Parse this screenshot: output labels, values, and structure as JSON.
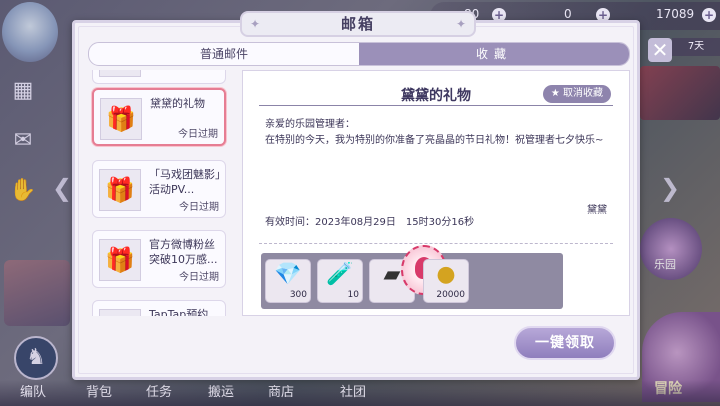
{
  "background": {
    "top_counts": [
      "80",
      "0",
      "17089"
    ],
    "day_badge": "7天",
    "tabs": [
      "编队",
      "背包",
      "任务",
      "搬运",
      "商店",
      "社团"
    ],
    "right_labels": {
      "garden": "乐园",
      "adventure": "冒险"
    }
  },
  "dialog": {
    "title": "邮箱",
    "tabs": [
      {
        "label": "普通邮件",
        "active": false
      },
      {
        "label": "收藏",
        "active": true
      }
    ]
  },
  "mail_list": [
    {
      "title": "",
      "expire": ""
    },
    {
      "title": "黛黛的礼物",
      "expire": "今日过期",
      "selected": true
    },
    {
      "title": "「马戏团魅影」活动PV...",
      "expire": "今日过期"
    },
    {
      "title": "官方微博粉丝突破10万感...",
      "expire": "今日过期"
    },
    {
      "title": "TapTap预约",
      "expire": ""
    }
  ],
  "letter": {
    "title": "黛黛的礼物",
    "unfavorite_label": "取消收藏",
    "greeting": "亲爱的乐园管理者：",
    "body": "在特别的今天，我为特别的你准备了亮晶晶的节日礼物！祝管理者七夕快乐~",
    "signer": "黛黛",
    "validity": "有效时间：2023年08月29日　15时30分16秒",
    "rewards": [
      {
        "icon": "diamond-icon",
        "qty": "300"
      },
      {
        "icon": "potion-icon",
        "qty": "10"
      },
      {
        "icon": "frame-icon",
        "qty": ""
      },
      {
        "icon": "coin-icon",
        "qty": "20000"
      }
    ]
  },
  "claim_all_label": "一键领取"
}
